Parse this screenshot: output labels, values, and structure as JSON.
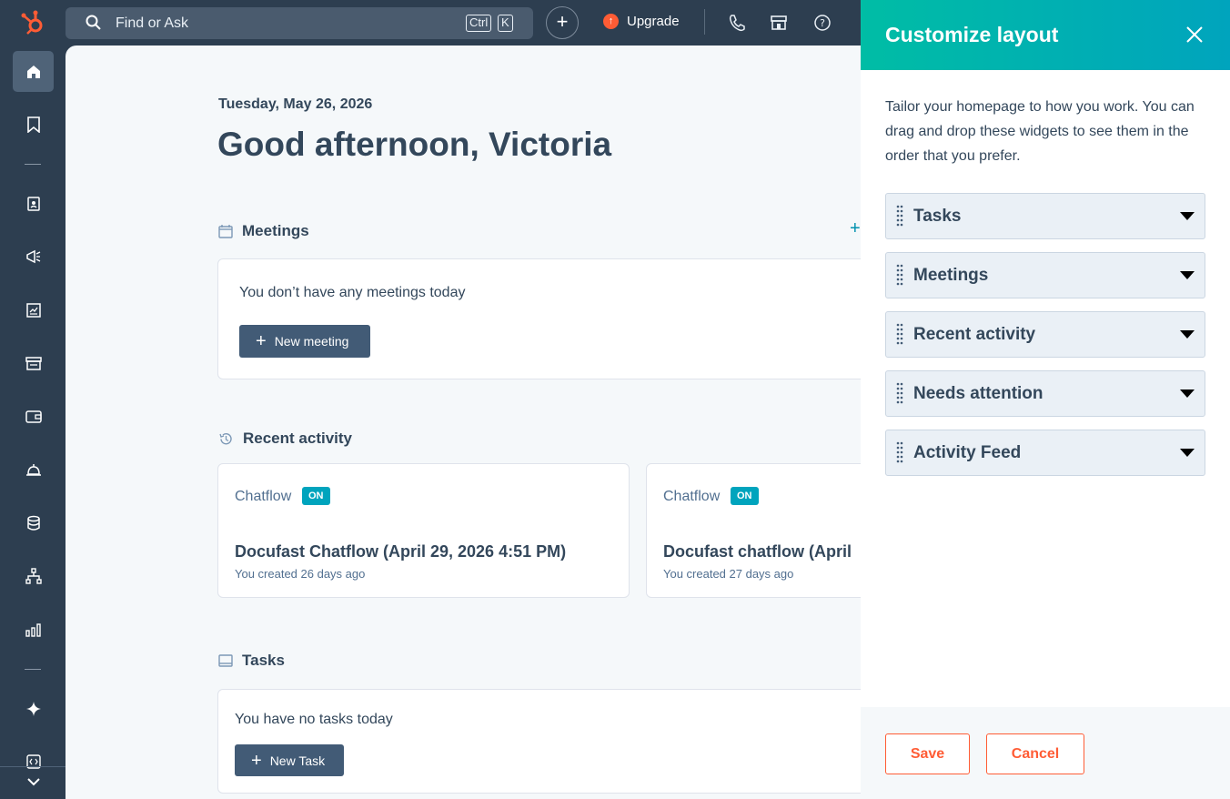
{
  "topbar": {
    "search_placeholder": "Find or Ask",
    "shortcut_ctrl": "Ctrl",
    "shortcut_key": "K",
    "upgrade_label": "Upgrade"
  },
  "main": {
    "date": "Tuesday, May 26, 2026",
    "greeting": "Good afternoon, Victoria",
    "meetings": {
      "title": "Meetings",
      "empty_text": "You don’t have any meetings today",
      "new_button": "New meeting"
    },
    "recent_activity": {
      "title": "Recent activity",
      "cards": [
        {
          "type": "Chatflow",
          "badge": "ON",
          "title": "Docufast Chatflow (April 29, 2026 4:51 PM)",
          "subtitle": "You created 26 days ago"
        },
        {
          "type": "Chatflow",
          "badge": "ON",
          "title": "Docufast chatflow (April",
          "subtitle": "You created 27 days ago"
        }
      ]
    },
    "tasks": {
      "title": "Tasks",
      "empty_text": "You have no tasks today",
      "new_button": "New Task"
    }
  },
  "panel": {
    "title": "Customize layout",
    "description": "Tailor your homepage to how you work. You can drag and drop these widgets to see them in the order that you prefer.",
    "widgets": [
      "Tasks",
      "Meetings",
      "Recent activity",
      "Needs attention",
      "Activity Feed"
    ],
    "save_label": "Save",
    "cancel_label": "Cancel"
  },
  "colors": {
    "nav_bg": "#2d3e50",
    "accent_teal": "#00a4bd",
    "accent_orange": "#ff5c35",
    "button_dark": "#425b76"
  },
  "icons": [
    "hubspot-logo-icon",
    "search-icon",
    "plus-icon",
    "upgrade-icon",
    "phone-icon",
    "marketplace-icon",
    "help-icon",
    "home-icon",
    "bookmark-icon",
    "contacts-icon",
    "marketing-icon",
    "content-icon",
    "commerce-icon",
    "payments-icon",
    "service-icon",
    "data-icon",
    "automation-icon",
    "reports-icon",
    "ai-sparkle-icon",
    "developer-icon",
    "expand-icon",
    "calendar-icon",
    "history-icon",
    "tasks-icon",
    "close-icon",
    "drag-handle-icon",
    "caret-down-icon"
  ]
}
